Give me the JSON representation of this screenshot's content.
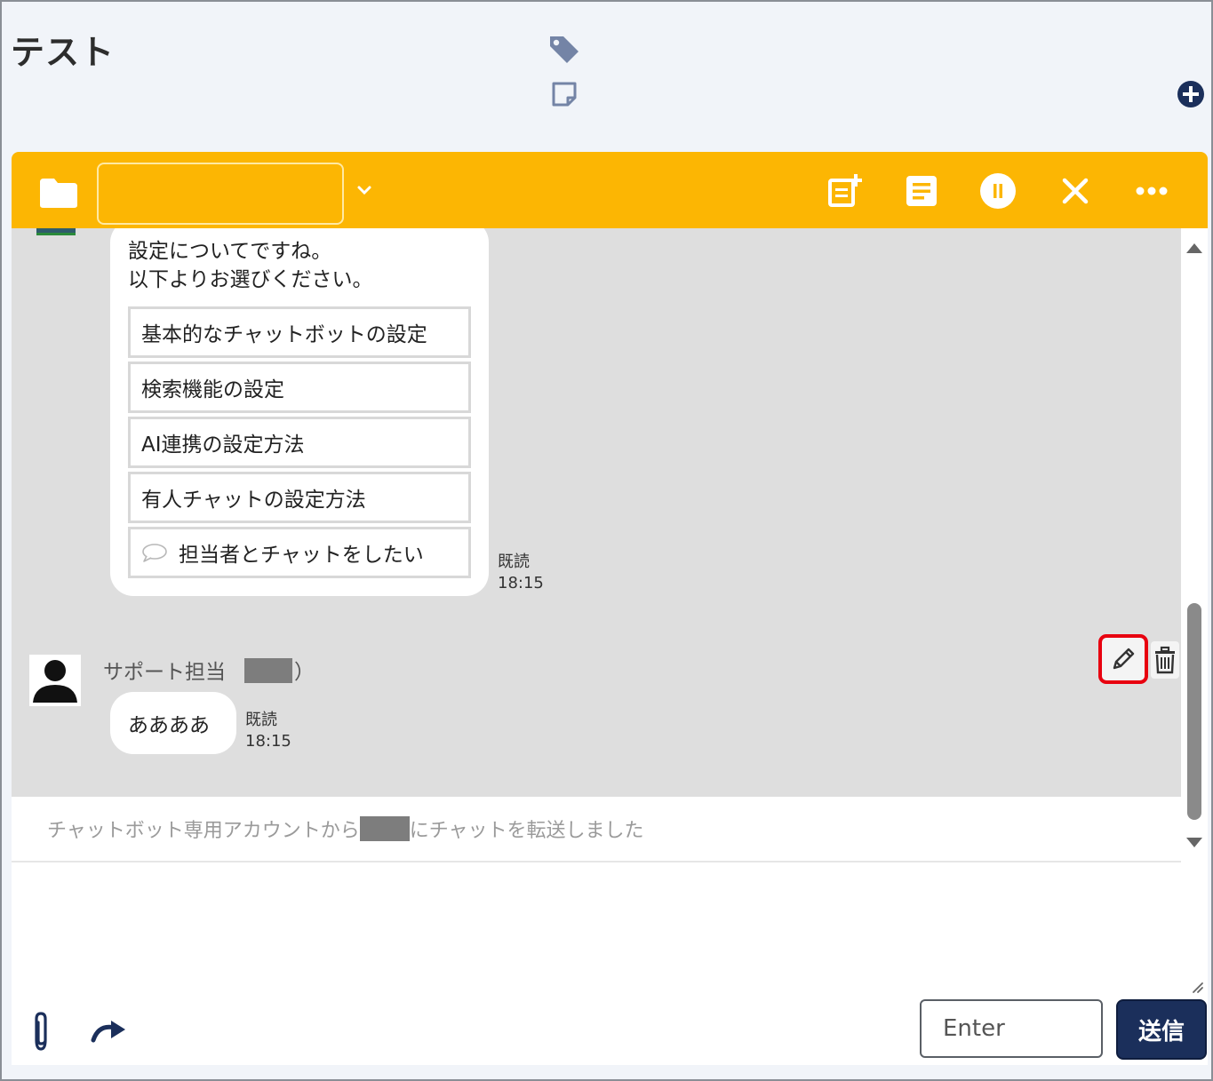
{
  "header": {
    "title": "テスト",
    "icons": {
      "tag": "tag-icon",
      "note": "sticky-note-icon",
      "add": "plus-circle-icon"
    }
  },
  "toolbar": {
    "folder_icon": "folder-icon",
    "select_value": "",
    "buttons": [
      "add-note-icon",
      "memo-icon",
      "pause-icon",
      "close-icon",
      "more-icon"
    ],
    "color": "#fcb603"
  },
  "messages": {
    "bot": {
      "lines": [
        "設定についてですね。",
        "以下よりお選びください。"
      ],
      "choices": [
        "基本的なチャットボットの設定",
        "検索機能の設定",
        "AI連携の設定方法",
        "有人チャットの設定方法",
        "担当者とチャットをしたい"
      ],
      "read": "既読",
      "time": "18:15"
    },
    "user": {
      "name": "サポート担当",
      "paren": "（",
      "paren_close": "）",
      "text": "ああああ",
      "read": "既読",
      "time": "18:15"
    }
  },
  "system": {
    "text_before": "チャットボット専用アカウントから",
    "text_after": "にチャットを転送しました"
  },
  "composer": {
    "input_value": "",
    "enter_option": "Enter",
    "send_label": "送信"
  },
  "colors": {
    "accent": "#fcb603",
    "send": "#1b2f5b",
    "highlight": "#e8000f"
  }
}
